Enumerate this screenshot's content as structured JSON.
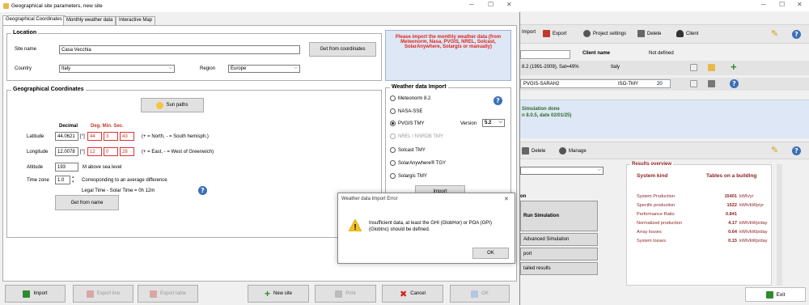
{
  "colors": {
    "accent_red": "#c0392b",
    "title_blue": "#3b6fb5",
    "sim_green": "#2f6c2f",
    "dark_red": "#8b1d1d"
  },
  "dialog": {
    "title": "Geographical site parameters, new site",
    "tabs": [
      "Geographical Coordinates",
      "Monthly weather data",
      "Interactive Map"
    ],
    "location": {
      "title": "Location",
      "site_name_label": "Site name",
      "site_name_value": "Casa Vecchia",
      "country_label": "Country",
      "country_value": "Italy",
      "region_label": "Region",
      "region_value": "Europe",
      "get_from_coordinates": "Get from coordinates"
    },
    "notice": "Please import the monthly weather data (from Meteonorm, Nasa, PVGIS, NREL, Solcast, SolarAnywhere, Solargis or manually)",
    "coords": {
      "title": "Geographical Coordinates",
      "sun_paths": "Sun paths",
      "decimal_header": "Decimal",
      "dms_header": "Deg. Min. Sec.",
      "latitude_label": "Latitude",
      "latitude_decimal": "44.0621",
      "latitude_unit": "[°]",
      "latitude_deg": "44",
      "latitude_min": "3",
      "latitude_sec": "43",
      "latitude_hint": "(+ = North, - = South hemisph.)",
      "longitude_label": "Longitude",
      "longitude_decimal": "12.0078",
      "longitude_unit": "[°]",
      "longitude_deg": "12",
      "longitude_min": "0",
      "longitude_sec": "28",
      "longitude_hint": "(+ = East, - = West of Greenwich)",
      "altitude_label": "Altitude",
      "altitude_value": "193",
      "altitude_unit": "M above sea level",
      "timezone_label": "Time zone",
      "timezone_value": "1.0",
      "timezone_hint": "Corresponding to an average difference",
      "legal_time": "Legal Time - Solar Time =  0h 12m",
      "get_from_name": "Get from name"
    },
    "weather_import": {
      "title": "Weather data Import",
      "options": [
        "Meteonorm 8.2",
        "NASA-SSE",
        "PVGIS TMY",
        "NREL / NSRDB TMY",
        "Solcast TMY",
        "SolarAnywhere® TGY",
        "Solargis TMY"
      ],
      "selected": "PVGIS TMY",
      "version_label": "Version",
      "version_value": "5.2",
      "import_label": "Import"
    },
    "footer": {
      "import": "Import",
      "export_line": "Export line",
      "export_table": "Export table",
      "new_site": "New site",
      "print": "Print",
      "cancel": "Cancel",
      "ok": "OK"
    }
  },
  "error": {
    "title": "Weather data Import Error",
    "message": "Insufficient data, at least the GHI (GlobHor) or POA (GPI) (GlobInc) should be defined.",
    "ok": "OK"
  },
  "main": {
    "toolbar": {
      "import": "Import",
      "export": "Export",
      "project_settings": "Project settings",
      "delete": "Delete",
      "client": "Client"
    },
    "client_name_label": "Client name",
    "client_name_value": "Not defined",
    "meteo_row": "8.2 (1991-2009), Sat=49%",
    "meteo_country": "Italy",
    "pvgis_field": "PVGIS-SARAH2",
    "pvgis_type": "ISO-TMY",
    "pvgis_version": "20",
    "sim_done": "Simulation done",
    "sim_version": "n 8.0.5, date 02/01/25)",
    "bar2": {
      "delete": "Delete",
      "manage": "Manage"
    },
    "sim_label": "on",
    "run_sim": "Run Simulation",
    "adv_sim": "Advanced Simulation",
    "report": "port",
    "detailed": "tailed results",
    "results": {
      "title": "Results overview",
      "system_kind_label": "System kind",
      "system_kind_value": "Tables on a building",
      "rows": [
        {
          "label": "System Production",
          "value": "15401",
          "unit": "kWh/yr"
        },
        {
          "label": "Specific production",
          "value": "1522",
          "unit": "kWh/kWp/yr"
        },
        {
          "label": "Performance Ratio",
          "value": "0.841",
          "unit": ""
        },
        {
          "label": "Normalized production",
          "value": "4.17",
          "unit": "kWh/kWp/day"
        },
        {
          "label": "Array losses",
          "value": "0.64",
          "unit": "kWh/kWp/day"
        },
        {
          "label": "System losses",
          "value": "0.15",
          "unit": "kWh/kWp/day"
        }
      ]
    },
    "exit": "Exit"
  }
}
